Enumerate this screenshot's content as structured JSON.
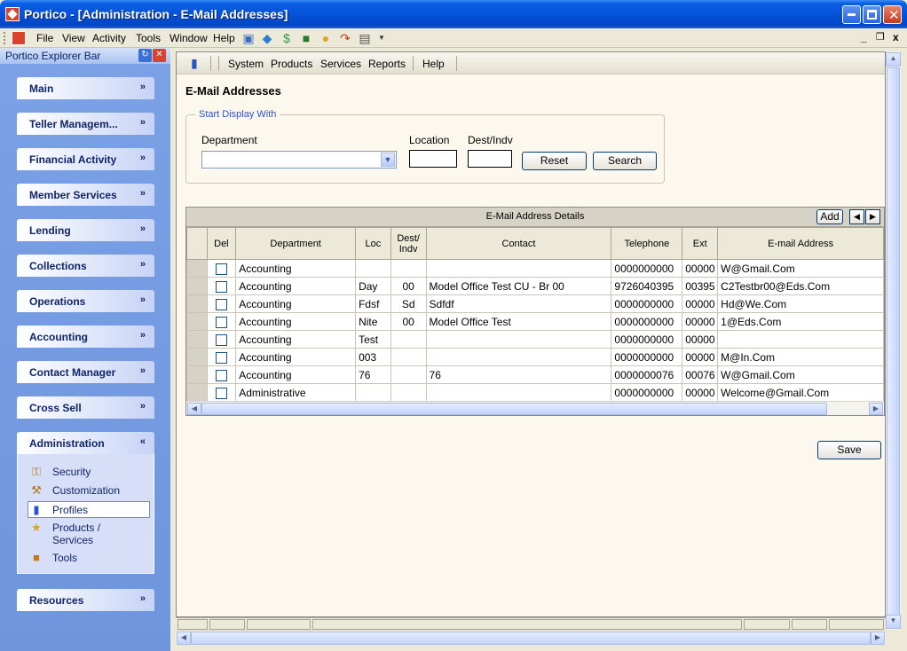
{
  "window": {
    "title": "Portico - [Administration - E-Mail Addresses]"
  },
  "menubar": {
    "items": [
      "File",
      "View",
      "Activity",
      "Tools",
      "Window",
      "Help"
    ],
    "mdi": {
      "minimize": "_",
      "restore": "ə",
      "close": "x"
    }
  },
  "explorer": {
    "title": "Portico Explorer Bar",
    "groups": [
      "Main",
      "Teller Managem...",
      "Financial Activity",
      "Member Services",
      "Lending",
      "Collections",
      "Operations",
      "Accounting",
      "Contact Manager",
      "Cross Sell",
      "Administration",
      "Resources"
    ],
    "admin_items": [
      "Security",
      "Customization",
      "Profiles",
      "Products / Services",
      "Tools"
    ],
    "chevron_down": "»",
    "chevron_up": "«"
  },
  "inner_toolbar": {
    "items": [
      "System",
      "Products",
      "Services",
      "Reports",
      "Help"
    ]
  },
  "page": {
    "title": "E-Mail Addresses",
    "filter": {
      "legend": "Start Display With",
      "department_label": "Department",
      "location_label": "Location",
      "dest_label": "Dest/Indv",
      "reset": "Reset",
      "search": "Search"
    },
    "save": "Save"
  },
  "grid": {
    "caption": "E-Mail Address Details",
    "add": "Add",
    "columns": [
      "",
      "Del",
      "Department",
      "Loc",
      "Dest/ Indv",
      "Contact",
      "Telephone",
      "Ext",
      "E-mail Address"
    ],
    "rows": [
      {
        "dept": "Accounting",
        "loc": "",
        "dest": "",
        "contact": "",
        "phone": "0000000000",
        "ext": "00000",
        "email": "W@Gmail.Com"
      },
      {
        "dept": "Accounting",
        "loc": "Day",
        "dest": "00",
        "contact": "Model Office Test CU - Br 00",
        "phone": "9726040395",
        "ext": "00395",
        "email": "C2Testbr00@Eds.Com"
      },
      {
        "dept": "Accounting",
        "loc": "Fdsf",
        "dest": "Sd",
        "contact": "Sdfdf",
        "phone": "0000000000",
        "ext": "00000",
        "email": "Hd@We.Com"
      },
      {
        "dept": "Accounting",
        "loc": "Nite",
        "dest": "00",
        "contact": "Model Office Test",
        "phone": "0000000000",
        "ext": "00000",
        "email": "1@Eds.Com"
      },
      {
        "dept": "Accounting",
        "loc": "Test",
        "dest": "",
        "contact": "",
        "phone": "0000000000",
        "ext": "00000",
        "email": ""
      },
      {
        "dept": "Accounting",
        "loc": "003",
        "dest": "",
        "contact": "",
        "phone": "0000000000",
        "ext": "00000",
        "email": "M@In.Com"
      },
      {
        "dept": "Accounting",
        "loc": "76",
        "dest": "",
        "contact": "76",
        "phone": "0000000076",
        "ext": "00076",
        "email": "W@Gmail.Com"
      },
      {
        "dept": "Administrative",
        "loc": "",
        "dest": "",
        "contact": "",
        "phone": "0000000000",
        "ext": "00000",
        "email": "Welcome@Gmail.Com"
      }
    ]
  }
}
